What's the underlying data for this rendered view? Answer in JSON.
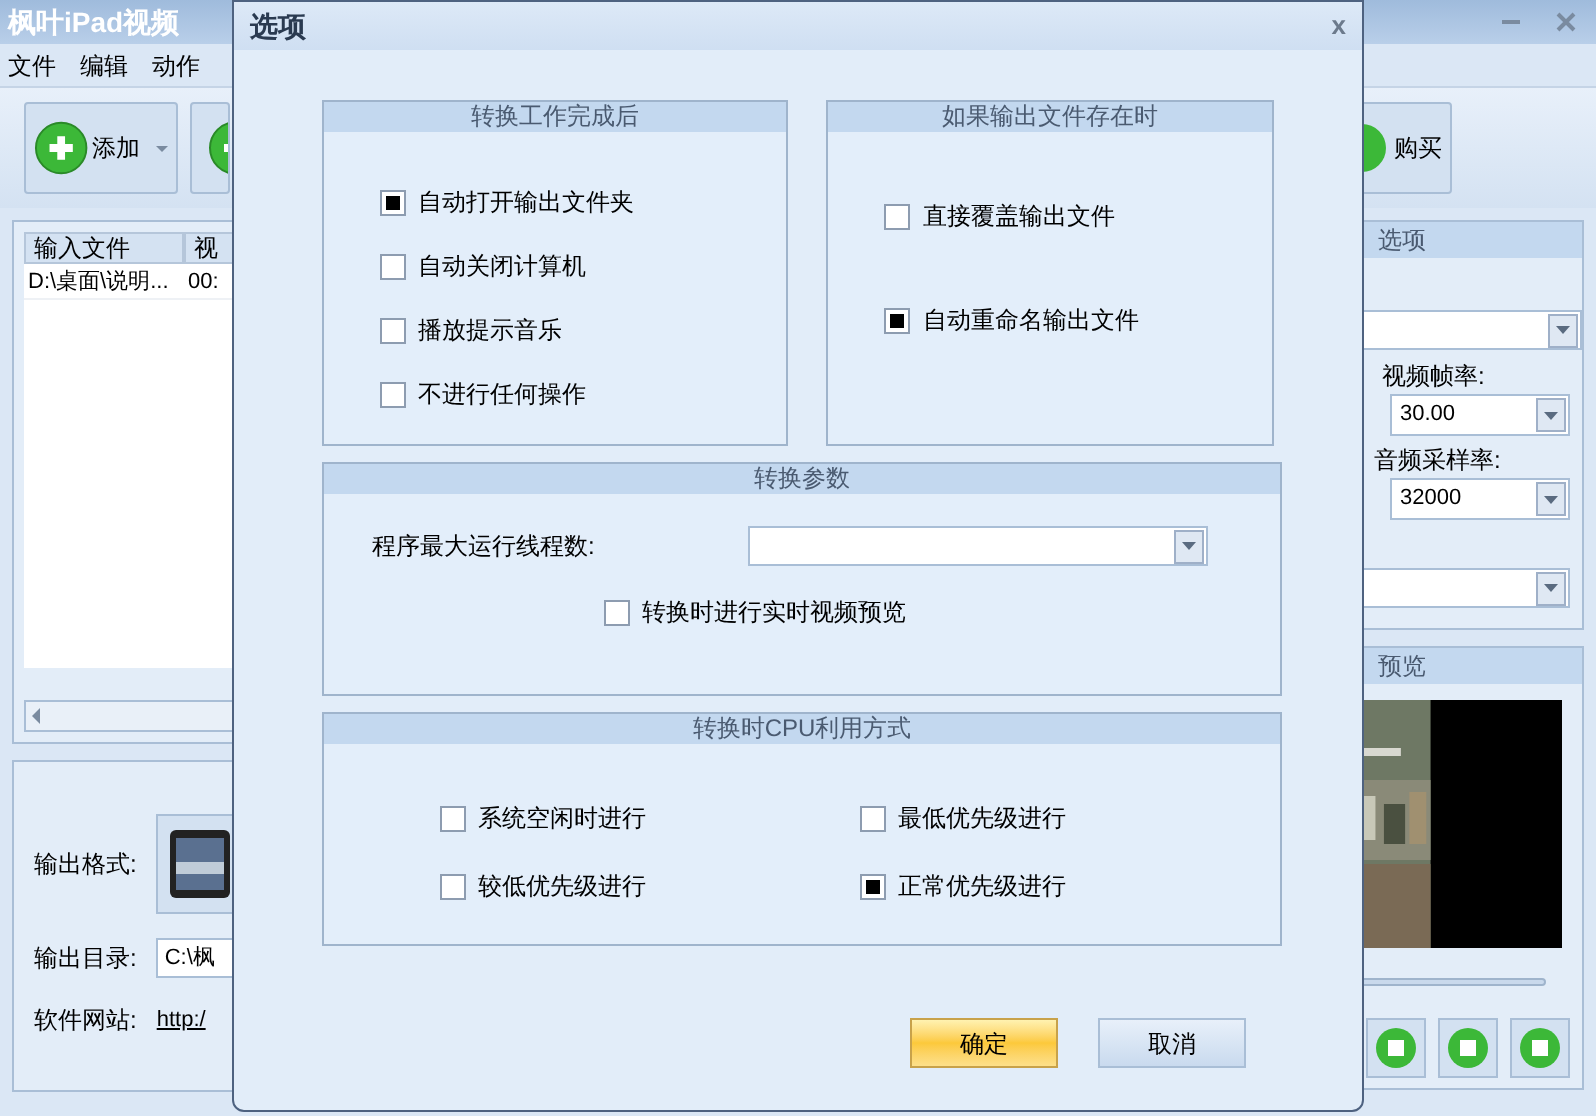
{
  "app": {
    "title": "枫叶iPad视频",
    "menu": [
      "文件",
      "编辑",
      "动作"
    ],
    "toolbar": [
      {
        "kind": "add",
        "label": "添加"
      },
      {
        "kind": "partial"
      },
      {
        "kind": "buy",
        "label": "购买"
      }
    ],
    "table": {
      "columns": [
        "输入文件",
        "视"
      ],
      "rows": [
        [
          "D:\\桌面\\说明...",
          "00:"
        ]
      ]
    },
    "options": {
      "title": "选项",
      "frame_rate_label": "视频帧率:",
      "frame_rate": "30.00",
      "sample_rate_label": "音频采样率:",
      "sample_rate": "32000"
    },
    "preview": {
      "title": "预览"
    },
    "output": {
      "format_label": "输出格式:",
      "dir_label": "输出目录:",
      "dir": "C:\\枫",
      "site_label": "软件网站:",
      "site": "http:/"
    }
  },
  "dialog": {
    "title": "选项",
    "close": "x",
    "after_done": {
      "title": "转换工作完成后",
      "options": [
        {
          "label": "自动打开输出文件夹",
          "checked": true
        },
        {
          "label": "自动关闭计算机",
          "checked": false
        },
        {
          "label": "播放提示音乐",
          "checked": false
        },
        {
          "label": "不进行任何操作",
          "checked": false
        }
      ]
    },
    "if_exists": {
      "title": "如果输出文件存在时",
      "options": [
        {
          "label": "直接覆盖输出文件",
          "checked": false
        },
        {
          "label": "自动重命名输出文件",
          "checked": true
        }
      ]
    },
    "params": {
      "title": "转换参数",
      "threads_label": "程序最大运行线程数:",
      "preview_option": {
        "label": "转换时进行实时视频预览",
        "checked": false
      }
    },
    "cpu": {
      "title": "转换时CPU利用方式",
      "options": [
        {
          "label": "系统空闲时进行",
          "checked": false
        },
        {
          "label": "最低优先级进行",
          "checked": false
        },
        {
          "label": "较低优先级进行",
          "checked": false
        },
        {
          "label": "正常优先级进行",
          "checked": true
        }
      ]
    },
    "buttons": [
      {
        "label": "确定",
        "kind": "primary"
      },
      {
        "label": "取消",
        "kind": "normal"
      }
    ]
  }
}
